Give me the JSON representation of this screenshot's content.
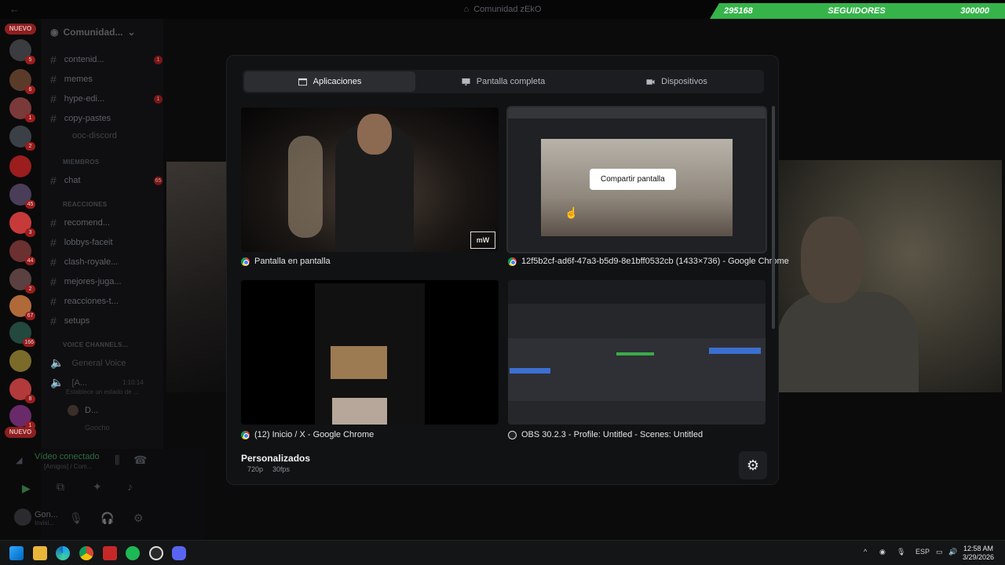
{
  "window": {
    "title": "Comunidad zEkO"
  },
  "followers": {
    "current": "295168",
    "label": "SEGUIDORES",
    "goal": "300000"
  },
  "rail": {
    "nuevo_top": "NUEVO",
    "nuevo_bottom": "NUEVO",
    "badges": [
      "5",
      "6",
      "1",
      "2",
      "45",
      "3",
      "44",
      "2",
      "67",
      "166",
      "8",
      "1"
    ]
  },
  "sidebar": {
    "guild_name": "Comunidad...",
    "channels": [
      {
        "name": "contenid...",
        "badge": "1"
      },
      {
        "name": "memes",
        "badge": ""
      },
      {
        "name": "hype-edi...",
        "badge": "1"
      },
      {
        "name": "copy-pastes",
        "badge": ""
      },
      {
        "name": "ooc-discord",
        "badge": ""
      }
    ],
    "cat_miembros": "MIEMBROS",
    "chat": {
      "name": "chat",
      "badge": "65"
    },
    "cat_reacciones": "REACCIONES",
    "channels2": [
      "recomend...",
      "lobbys-faceit",
      "clash-royale...",
      "mejores-juga...",
      "reacciones-t...",
      "setups"
    ],
    "cat_voice": "VOICE CHANNELS...",
    "voice1": "General Voice",
    "voice2": "[A...",
    "voice2_time": "1:10:14",
    "voice2_sub": "Establece un estado de ...",
    "member1": "D...",
    "member2": "Goocho",
    "panel": {
      "title": "Vídeo conectado",
      "sub": "[Amigos] / Com...",
      "user": "Gon...",
      "user_status": "Invisi..."
    }
  },
  "modal": {
    "tabs": [
      {
        "label": "Aplicaciones",
        "icon": "window-icon"
      },
      {
        "label": "Pantalla completa",
        "icon": "monitor-icon"
      },
      {
        "label": "Dispositivos",
        "icon": "camera-icon"
      }
    ],
    "sources": [
      {
        "label": "Pantalla en pantalla",
        "icon": "chrome-icon"
      },
      {
        "label": "12f5b2cf-ad6f-47a3-b5d9-8e1bff0532cb (1433×736) - Google Chrome",
        "icon": "chrome-icon"
      },
      {
        "label": "(12) Inicio / X - Google Chrome",
        "icon": "chrome-icon"
      },
      {
        "label": "OBS 30.2.3 - Profile: Untitled - Scenes: Untitled",
        "icon": "obs-icon"
      }
    ],
    "share_button": "Compartir pantalla",
    "custom_title": "Personalizados",
    "resolution": "720p",
    "fps": "30fps"
  },
  "taskbar": {
    "lang": "ESP",
    "time": "12:58 AM",
    "date": "3/29/2026"
  }
}
